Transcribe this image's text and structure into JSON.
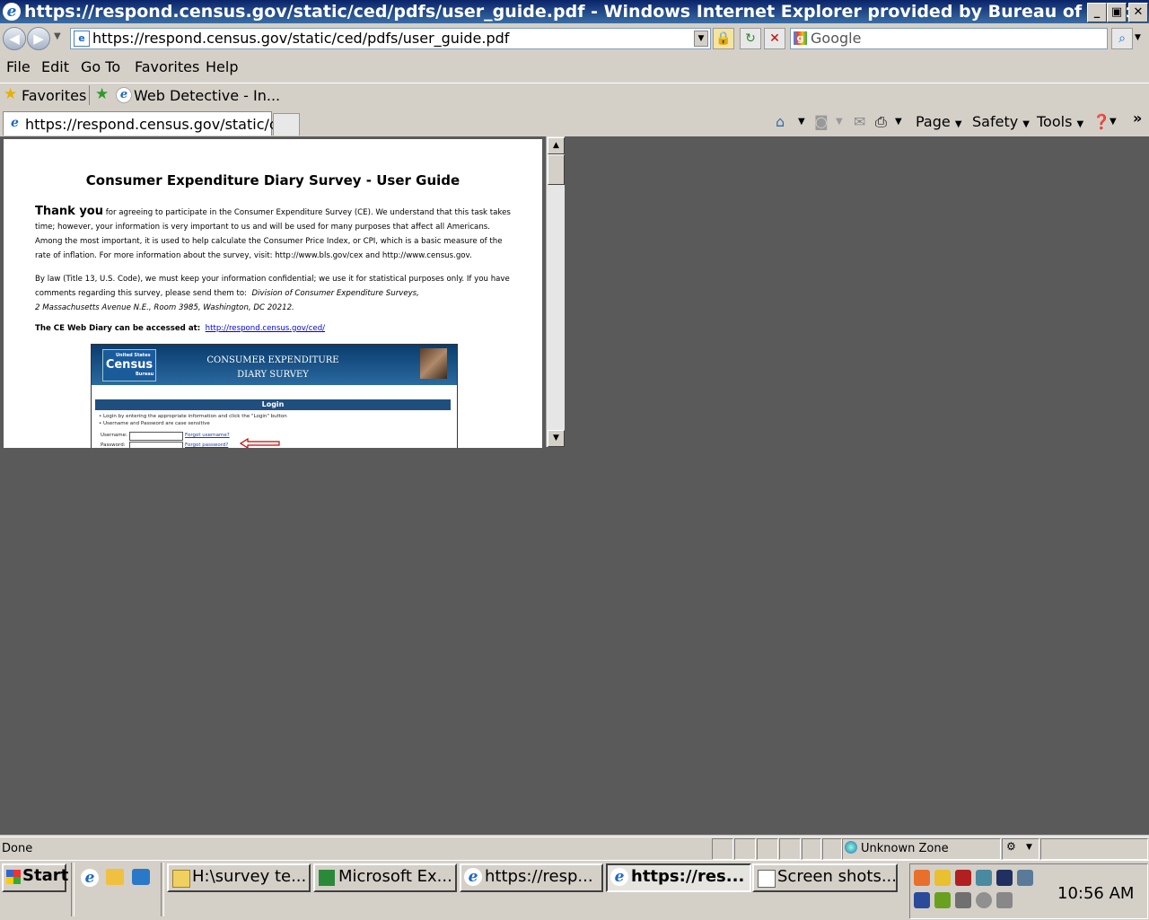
{
  "window": {
    "title": "https://respond.census.gov/static/ced/pdfs/user_guide.pdf - Windows Internet Explorer provided by Bureau of Labor S...",
    "min": "_",
    "max": "▣",
    "close": "✕"
  },
  "address": {
    "url": "https://respond.census.gov/static/ced/pdfs/user_guide.pdf",
    "search_placeholder": "Google"
  },
  "menu": [
    "File",
    "Edit",
    "Go To",
    "Favorites",
    "Help"
  ],
  "favorites": {
    "label": "Favorites",
    "item": "Web Detective - In..."
  },
  "tabs": {
    "active": "https://respond.census.gov/static/c..."
  },
  "commands": {
    "page": "Page",
    "safety": "Safety",
    "tools": "Tools",
    "more": "»"
  },
  "document": {
    "title": "Consumer Expenditure Diary Survey - User Guide",
    "thank_you": "Thank you",
    "para1": " for agreeing to participate in the Consumer Expenditure Survey (CE). We understand that this task takes time; however, your information is very important to us and will be used for many purposes that affect all Americans. Among the most important, it is used to help calculate the Consumer Price Index, or CPI, which is a basic measure of the rate of inflation. For more information about the survey, visit: http://www.bls.gov/cex and http://www.census.gov.",
    "para2_line1": "By law (Title 13, U.S. Code), we must keep your information confidential; we use it for statistical purposes only. If you have comments regarding this survey, please send them to:",
    "para2_addr1": "Division of Consumer Expenditure Surveys,",
    "para2_addr2": "2 Massachusetts Avenue N.E., Room 3985, Washington, DC 20212.",
    "access_label": "The CE Web Diary can be accessed at:",
    "access_link": "http://respond.census.gov/ced/"
  },
  "embedded": {
    "logo_small": "United States",
    "logo": "Census",
    "logo_sub": "Bureau",
    "title_line1": "CONSUMER EXPENDITURE",
    "title_line2": "DIARY SURVEY",
    "login_header": "Login",
    "bullet1": "• Login by entering the appropriate information and click the \"Login\" button",
    "bullet2": "• Username and Password are case sensitive",
    "username_label": "Username:",
    "password_label": "Password:",
    "forgot_username": "Forgot username?",
    "forgot_password": "Forgot password?"
  },
  "status": {
    "text": "Done",
    "zone": "Unknown Zone"
  },
  "taskbar": {
    "start": "Start",
    "items": [
      {
        "label": "H:\\survey te..."
      },
      {
        "label": "Microsoft Ex..."
      },
      {
        "label": "https://resp..."
      },
      {
        "label": "https://res..."
      },
      {
        "label": "Screen shots..."
      }
    ],
    "clock": "10:56 AM"
  },
  "colors": {
    "titlebar": "#0a246a",
    "content_bg": "#5a5a5a",
    "link": "#0000ee"
  }
}
